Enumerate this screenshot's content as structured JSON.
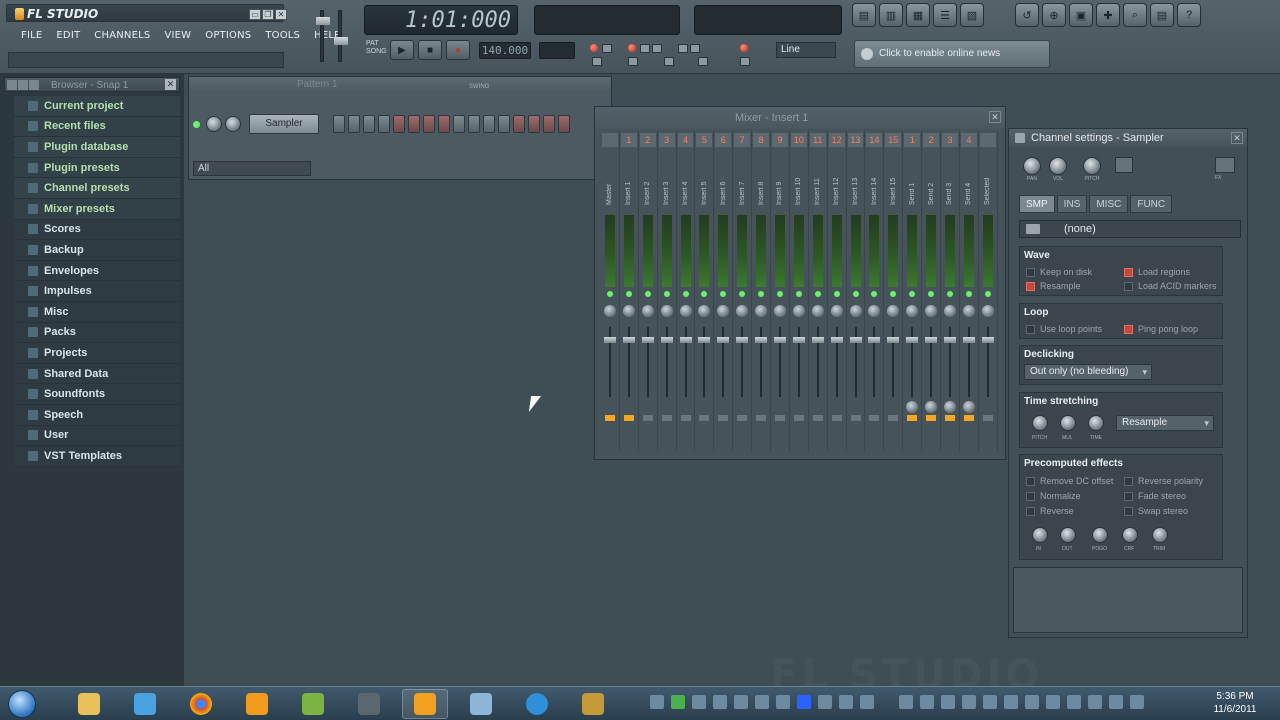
{
  "app": {
    "title": "FL STUDIO",
    "window_buttons": [
      "▭",
      "❐",
      "✕"
    ]
  },
  "menu": [
    "FILE",
    "EDIT",
    "CHANNELS",
    "VIEW",
    "OPTIONS",
    "TOOLS",
    "HELP"
  ],
  "transport": {
    "time": "1:01:000",
    "pat_song": [
      "PAT",
      "SONG"
    ],
    "tempo": "140.000",
    "buttons": [
      "▶",
      "■",
      "●"
    ],
    "snap": "Line",
    "news": "Click to enable online news"
  },
  "shortcut_icons": [
    "playlist-icon",
    "piano-roll-icon",
    "channel-rack-icon",
    "mixer-icon",
    "browser-icon",
    "undo-icon",
    "plugin-icon",
    "save-icon",
    "tools-icon",
    "search-icon",
    "template-icon",
    "help-icon"
  ],
  "browser": {
    "title": "Browser - Snap 1",
    "items": [
      {
        "label": "Current project",
        "type": "green"
      },
      {
        "label": "Recent files",
        "type": "green"
      },
      {
        "label": "Plugin database",
        "type": "green"
      },
      {
        "label": "Plugin presets",
        "type": "green"
      },
      {
        "label": "Channel presets",
        "type": "green"
      },
      {
        "label": "Mixer presets",
        "type": "green"
      },
      {
        "label": "Scores",
        "type": "plain"
      },
      {
        "label": "Backup",
        "type": "plain"
      },
      {
        "label": "Envelopes",
        "type": "plain"
      },
      {
        "label": "Impulses",
        "type": "plain"
      },
      {
        "label": "Misc",
        "type": "plain"
      },
      {
        "label": "Packs",
        "type": "plain"
      },
      {
        "label": "Projects",
        "type": "plain"
      },
      {
        "label": "Shared Data",
        "type": "plain"
      },
      {
        "label": "Soundfonts",
        "type": "plain"
      },
      {
        "label": "Speech",
        "type": "plain"
      },
      {
        "label": "User",
        "type": "plain"
      },
      {
        "label": "VST Templates",
        "type": "plain"
      }
    ]
  },
  "step_sequencer": {
    "pattern": "Pattern 1",
    "swing_label": "SWING",
    "channel": "Sampler",
    "filter": "All",
    "steps": 16
  },
  "mixer": {
    "title": "Mixer - Insert 1",
    "tracks": [
      {
        "num": "",
        "name": "Master",
        "send": false,
        "route": true
      },
      {
        "num": "1",
        "name": "Insert 1",
        "send": false,
        "route": true
      },
      {
        "num": "2",
        "name": "Insert 2",
        "send": false,
        "route": false
      },
      {
        "num": "3",
        "name": "Insert 3",
        "send": false,
        "route": false
      },
      {
        "num": "4",
        "name": "Insert 4",
        "send": false,
        "route": false
      },
      {
        "num": "5",
        "name": "Insert 5",
        "send": false,
        "route": false
      },
      {
        "num": "6",
        "name": "Insert 6",
        "send": false,
        "route": false
      },
      {
        "num": "7",
        "name": "Insert 7",
        "send": false,
        "route": false
      },
      {
        "num": "8",
        "name": "Insert 8",
        "send": false,
        "route": false
      },
      {
        "num": "9",
        "name": "Insert 9",
        "send": false,
        "route": false
      },
      {
        "num": "10",
        "name": "Insert 10",
        "send": false,
        "route": false
      },
      {
        "num": "11",
        "name": "Insert 11",
        "send": false,
        "route": false
      },
      {
        "num": "12",
        "name": "Insert 12",
        "send": false,
        "route": false
      },
      {
        "num": "13",
        "name": "Insert 13",
        "send": false,
        "route": false
      },
      {
        "num": "14",
        "name": "Insert 14",
        "send": false,
        "route": false
      },
      {
        "num": "15",
        "name": "Insert 15",
        "send": false,
        "route": false
      },
      {
        "num": "1",
        "name": "Send 1",
        "send": true,
        "route": true
      },
      {
        "num": "2",
        "name": "Send 2",
        "send": true,
        "route": true
      },
      {
        "num": "3",
        "name": "Send 3",
        "send": true,
        "route": true
      },
      {
        "num": "4",
        "name": "Send 4",
        "send": true,
        "route": true
      },
      {
        "num": "",
        "name": "Selected",
        "send": false,
        "route": false
      }
    ]
  },
  "channel_settings": {
    "title": "Channel settings - Sampler",
    "top_knobs": [
      "PAN",
      "VOL",
      "PITCH"
    ],
    "fx_label": "FX",
    "tabs": [
      "SMP",
      "INS",
      "MISC",
      "FUNC"
    ],
    "sample": "(none)",
    "wave_title": "Wave",
    "wave_options": [
      "Keep on disk",
      "Resample",
      "Load regions",
      "Load ACID markers"
    ],
    "loop_title": "Loop",
    "loop_options": [
      "Use loop points",
      "Ping pong loop"
    ],
    "declicking_title": "Declicking",
    "declicking_value": "Out only (no bleeding)",
    "timestretch_title": "Time stretching",
    "timestretch_knobs": [
      "PITCH",
      "MUL",
      "TIME"
    ],
    "timestretch_value": "Resample",
    "precomputed_title": "Precomputed effects",
    "precomputed_left": [
      "Remove DC offset",
      "Normalize",
      "Reverse"
    ],
    "precomputed_right": [
      "Reverse polarity",
      "Fade stereo",
      "Swap stereo"
    ],
    "precomputed_knobs": [
      "IN",
      "OUT",
      "POGO",
      "CRF",
      "TRIM"
    ]
  },
  "workspace_brand": "FL STUDIO",
  "taskbar": {
    "apps": [
      "explorer-icon",
      "windows-live-icon",
      "chrome-icon",
      "fl-studio-icon",
      "fl-studio-fruit-icon",
      "fl-studio-active-icon",
      "media-icon",
      "notepad-icon",
      "ie-icon",
      "movie-icon",
      "archive-icon"
    ],
    "clock_time": "5:36 PM",
    "clock_date": "11/6/2011"
  },
  "colors": {
    "accent_orange": "#f5a623",
    "led_green": "#6ef06b",
    "record_red": "#c14a3d"
  }
}
